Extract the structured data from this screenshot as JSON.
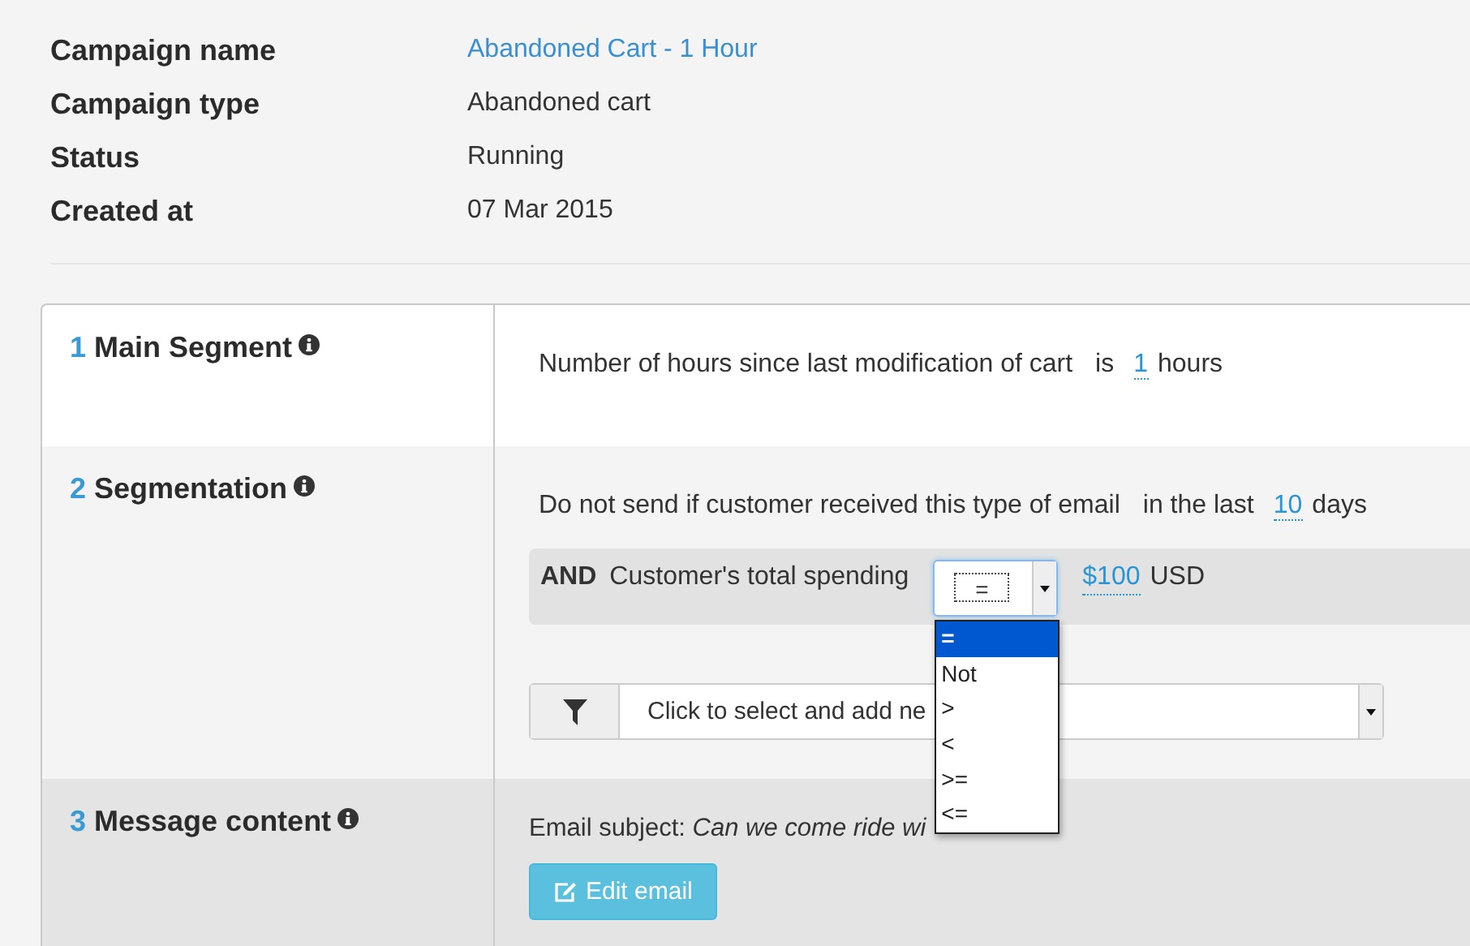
{
  "details": [
    {
      "label": "Campaign name",
      "value": "Abandoned Cart - 1 Hour",
      "kind": "link"
    },
    {
      "label": "Campaign type",
      "value": "Abandoned cart",
      "kind": "text"
    },
    {
      "label": "Status",
      "value": "Running",
      "kind": "text"
    },
    {
      "label": "Created at",
      "value": "07 Mar 2015",
      "kind": "text"
    }
  ],
  "main_segment": {
    "number": "1",
    "title": "Main Segment",
    "condition": {
      "field": "Number of hours since last modification of cart",
      "operator": "is",
      "value": "1",
      "unit": "hours"
    }
  },
  "segmentation": {
    "number": "2",
    "title": "Segmentation",
    "condition": {
      "field": "Do not send if customer received this type of email",
      "operator": "in the last",
      "value": "10",
      "unit": "days"
    },
    "and_rule": {
      "connector": "AND",
      "field": "Customer's total spending",
      "operator_select": {
        "value": "=",
        "expanded": true,
        "options": [
          {
            "label": "=",
            "selected": true
          },
          {
            "label": "Not",
            "selected": false
          },
          {
            "label": ">",
            "selected": false
          },
          {
            "label": "<",
            "selected": false
          },
          {
            "label": ">=",
            "selected": false
          },
          {
            "label": "<=",
            "selected": false
          }
        ]
      },
      "value": "$100",
      "unit": "USD"
    },
    "add_condition": {
      "placeholder": "Click to select and add ne"
    }
  },
  "message_content": {
    "number": "3",
    "title": "Message content",
    "subject_label": "Email subject:",
    "subject": "Can we come ride wi",
    "button": "Edit email"
  }
}
